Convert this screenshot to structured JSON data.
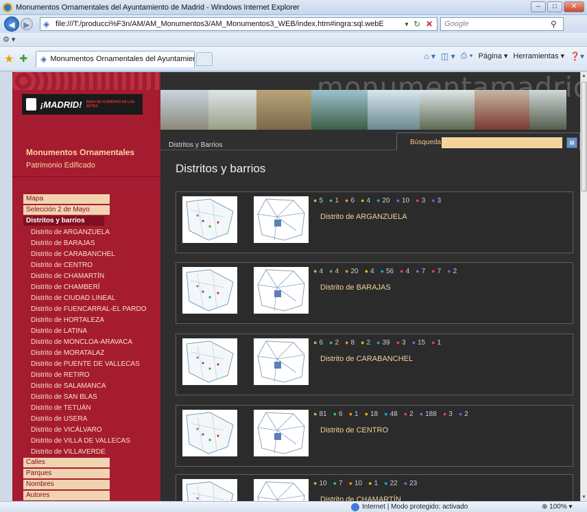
{
  "window": {
    "title": "Monumentos Ornamentales del Ayuntamiento de Madrid - Windows Internet Explorer"
  },
  "address_bar": {
    "url": "file:///T:/producci%F3n/AM/AM_Monumentos3/AM_Monumentos3_WEB/index.htm#ingra:sql.webE",
    "search_placeholder": "Google"
  },
  "tab": {
    "label": "Monumentos Ornamentales del Ayuntamiento d..."
  },
  "command_bar": {
    "page": "Página",
    "tools": "Herramientas"
  },
  "sidebar": {
    "logo_text": "¡MADRID!",
    "logo_area": "ÁREA DE GOBIERNO DE LAS ARTES",
    "title": "Monumentos Ornamentales",
    "subtitle": "Patrimonio Edificado",
    "menu_top": [
      {
        "label": "Mapa"
      },
      {
        "label": "Selección 2 de Mayo"
      }
    ],
    "active_item": "Distritos y barrios",
    "districts": [
      "Distrito de ARGANZUELA",
      "Distrito de BARAJAS",
      "Distrito de CARABANCHEL",
      "Distrito de CENTRO",
      "Distrito de CHAMARTÍN",
      "Distrito de CHAMBERÍ",
      "Distrito de CIUDAD LINEAL",
      "Distrito de FUENCARRAL-EL PARDO",
      "Distrito de HORTALEZA",
      "Distrito de LATINA",
      "Distrito de MONCLOA-ARAVACA",
      "Distrito de MORATALAZ",
      "Distrito de PUENTE DE VALLECAS",
      "Distrito de RETIRO",
      "Distrito de SALAMANCA",
      "Distrito de SAN BLAS",
      "Distrito de TETUÁN",
      "Distrito de USERA",
      "Distrito de VICÁLVARO",
      "Distrito de VILLA DE VALLECAS",
      "Distrito de VILLAVERDE"
    ],
    "menu_bottom": [
      {
        "label": "Calles"
      },
      {
        "label": "Parques"
      },
      {
        "label": "Nombres"
      },
      {
        "label": "Autores"
      }
    ]
  },
  "header": {
    "brand": "monumentamadrid",
    "breadcrumb": "Distritos y Barrios",
    "search_label": "Búsqueda"
  },
  "main": {
    "heading": "Distritos y barrios",
    "districts": [
      {
        "name": "Distrito de ARGANZUELA",
        "counts": [
          {
            "value": "5",
            "color": "#7ed957"
          },
          {
            "value": "1",
            "color": "#3fbf4f"
          },
          {
            "value": "6",
            "color": "#f28c28"
          },
          {
            "value": "4",
            "color": "#e8b600"
          },
          {
            "value": "20",
            "color": "#1fa3d8"
          },
          {
            "value": "10",
            "color": "#9b59d0"
          },
          {
            "value": "3",
            "color": "#e04a3a"
          },
          {
            "value": "3",
            "color": "#4a6fd0"
          }
        ]
      },
      {
        "name": "Distrito de BARAJAS",
        "counts": [
          {
            "value": "4",
            "color": "#7ed957"
          },
          {
            "value": "4",
            "color": "#3fbf4f"
          },
          {
            "value": "20",
            "color": "#f28c28"
          },
          {
            "value": "4",
            "color": "#e8b600"
          },
          {
            "value": "56",
            "color": "#1fa3d8"
          },
          {
            "value": "4",
            "color": "#e04a3a"
          },
          {
            "value": "7",
            "color": "#9b59d0"
          },
          {
            "value": "7",
            "color": "#e04a3a"
          },
          {
            "value": "2",
            "color": "#4a6fd0"
          }
        ]
      },
      {
        "name": "Distrito de CARABANCHEL",
        "counts": [
          {
            "value": "6",
            "color": "#7ed957"
          },
          {
            "value": "2",
            "color": "#3fbf4f"
          },
          {
            "value": "8",
            "color": "#f28c28"
          },
          {
            "value": "2",
            "color": "#e8b600"
          },
          {
            "value": "39",
            "color": "#1fa3d8"
          },
          {
            "value": "3",
            "color": "#e04a3a"
          },
          {
            "value": "15",
            "color": "#9b59d0"
          },
          {
            "value": "1",
            "color": "#e04a3a"
          }
        ]
      },
      {
        "name": "Distrito de CENTRO",
        "counts": [
          {
            "value": "81",
            "color": "#7ed957"
          },
          {
            "value": "6",
            "color": "#3fbf4f"
          },
          {
            "value": "1",
            "color": "#f28c28"
          },
          {
            "value": "18",
            "color": "#e8b600"
          },
          {
            "value": "48",
            "color": "#1fa3d8"
          },
          {
            "value": "2",
            "color": "#e04a3a"
          },
          {
            "value": "188",
            "color": "#9b59d0"
          },
          {
            "value": "3",
            "color": "#e04a3a"
          },
          {
            "value": "2",
            "color": "#4a6fd0"
          }
        ]
      },
      {
        "name": "Distrito de CHAMARTÍN",
        "counts": [
          {
            "value": "10",
            "color": "#7ed957"
          },
          {
            "value": "7",
            "color": "#3fbf4f"
          },
          {
            "value": "10",
            "color": "#f28c28"
          },
          {
            "value": "1",
            "color": "#e8b600"
          },
          {
            "value": "22",
            "color": "#1fa3d8"
          },
          {
            "value": "23",
            "color": "#9b59d0"
          }
        ]
      }
    ]
  },
  "status_bar": {
    "text": "Internet | Modo protegido: activado",
    "zoom": "100%"
  }
}
